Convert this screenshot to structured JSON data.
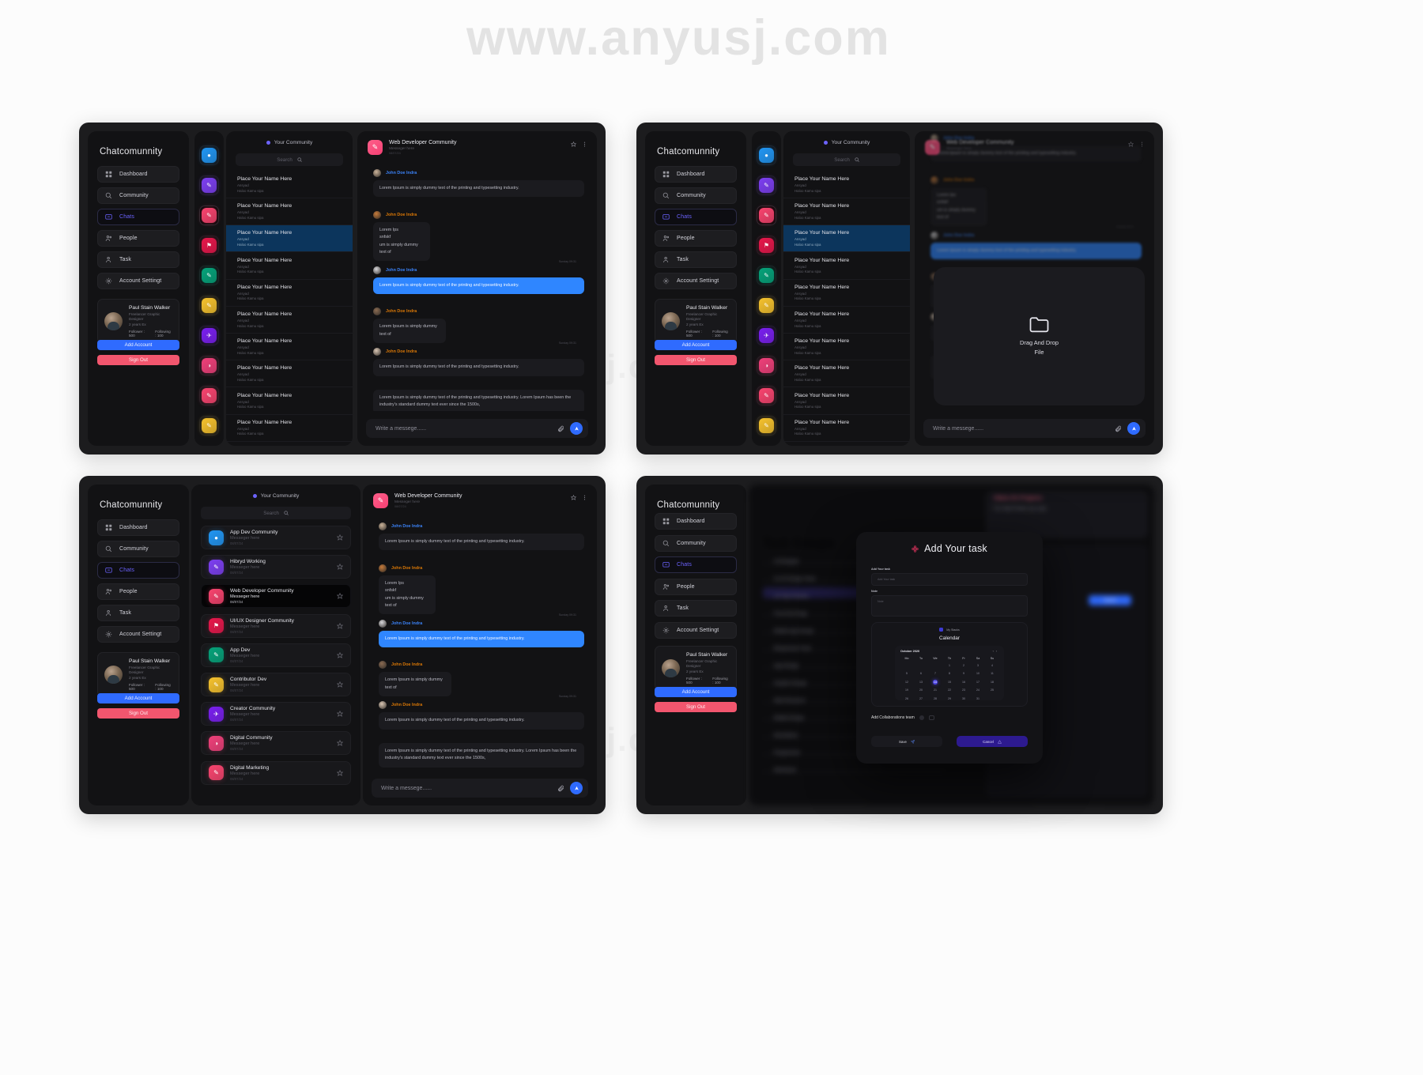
{
  "watermarks": {
    "top": "www.anyusj.com",
    "mid": "www.anyusj.com",
    "bottom": "www.anyusj.com"
  },
  "sidebar": {
    "brand": "Chatcomunnity",
    "items": [
      {
        "label": "Dashboard",
        "icon": "grid-icon",
        "active": false
      },
      {
        "label": "Community",
        "icon": "community-icon",
        "active": false
      },
      {
        "label": "Chats",
        "icon": "chat-icon",
        "active": true
      },
      {
        "label": "People",
        "icon": "people-icon",
        "active": false
      },
      {
        "label": "Task",
        "icon": "task-icon",
        "active": false
      },
      {
        "label": "Account Settingt",
        "icon": "gear-icon",
        "active": false
      }
    ],
    "profile": {
      "name": "Paul Stain Walker",
      "role": "Freelancer Graphic Designer",
      "role2": "2 years Ex",
      "followers": "Follower : 500",
      "following": "Following : 100"
    },
    "add_account": "Add Account",
    "sign_out": "Sign Out"
  },
  "rail": {
    "icons": [
      {
        "name": "app-dev-community-icon",
        "color": "#2196f3",
        "glyph": "●"
      },
      {
        "name": "hibryd-working-icon",
        "color": "#7d3ff2",
        "glyph": "✎"
      },
      {
        "name": "web-developer-community-icon",
        "color": "#f9446f",
        "glyph": "✎",
        "selected": true
      },
      {
        "name": "uiux-designer-community-icon",
        "color": "#e8174b",
        "glyph": "⚑"
      },
      {
        "name": "app-dev-icon",
        "color": "#05a37a",
        "glyph": "✎"
      },
      {
        "name": "contributor-dev-icon",
        "color": "#f6c game",
        "glyph": "✎"
      },
      {
        "name": "creator-community-icon",
        "color": "#7a1ff0",
        "glyph": "✈"
      },
      {
        "name": "digital-community-icon",
        "color": "#f0407a",
        "glyph": "◑"
      },
      {
        "name": "digital-marketing-icon",
        "color": "#f9446f",
        "glyph": "✎"
      },
      {
        "name": "extra-icon",
        "color": "#f6c22d",
        "glyph": "✎"
      }
    ]
  },
  "chat_list": {
    "header": "Your Community",
    "search_placeholder": "Search",
    "items": [
      {
        "name": "Place Your Name Here",
        "sub": "Ansyad",
        "sub2": "Haloo Kamu sipa",
        "selected": false
      },
      {
        "name": "Place Your Name Here",
        "sub": "Ansyad",
        "sub2": "Haloo Kamu sipa",
        "selected": false
      },
      {
        "name": "Place Your Name Here",
        "sub": "Ansyad",
        "sub2": "Haloo Kamu sipa",
        "selected": true
      },
      {
        "name": "Place Your Name Here",
        "sub": "Ansyad",
        "sub2": "Haloo Kamu sipa",
        "selected": false
      },
      {
        "name": "Place Your Name Here",
        "sub": "Ansyad",
        "sub2": "Haloo Kamu sipa",
        "selected": false
      },
      {
        "name": "Place Your Name Here",
        "sub": "Ansyad",
        "sub2": "Haloo Kamu sipa",
        "selected": false
      },
      {
        "name": "Place Your Name Here",
        "sub": "Ansyad",
        "sub2": "Haloo Kamu sipa",
        "selected": false
      },
      {
        "name": "Place Your Name Here",
        "sub": "Ansyad",
        "sub2": "Haloo Kamu sipa",
        "selected": false
      },
      {
        "name": "Place Your Name Here",
        "sub": "Ansyad",
        "sub2": "Haloo Kamu sipa",
        "selected": false
      },
      {
        "name": "Place Your Name Here",
        "sub": "Ansyad",
        "sub2": "Haloo Kamu sipa",
        "selected": false
      }
    ]
  },
  "community_list": {
    "header": "Your Community",
    "search_placeholder": "Search",
    "items": [
      {
        "name": "App Dev Community",
        "message": "Messeger here",
        "date": "08/07/24",
        "color": "#2196f3",
        "glyph": "●",
        "selected": false
      },
      {
        "name": "Hibryd Working",
        "message": "Messeger here",
        "date": "08/07/24",
        "color": "#7d3ff2",
        "glyph": "✎",
        "selected": false
      },
      {
        "name": "Web Developer Community",
        "message": "Messeger here",
        "date": "08/07/24",
        "color": "#f9446f",
        "glyph": "✎",
        "selected": true
      },
      {
        "name": "UI/UX Designer Community",
        "message": "Messeger here",
        "date": "08/07/24",
        "color": "#e8174b",
        "glyph": "⚑",
        "selected": false
      },
      {
        "name": "App Dev",
        "message": "Messeger here",
        "date": "08/07/24",
        "color": "#05a37a",
        "glyph": "✎",
        "selected": false
      },
      {
        "name": "Contributor Dev",
        "message": "Messeger here",
        "date": "08/07/24",
        "color": "#f6c22d",
        "glyph": "✎",
        "selected": false
      },
      {
        "name": "Creator Community",
        "message": "Messeger here",
        "date": "08/07/24",
        "color": "#7a1ff0",
        "glyph": "✈",
        "selected": false
      },
      {
        "name": "Digital Community",
        "message": "Messeger here",
        "date": "08/07/24",
        "color": "#f0407a",
        "glyph": "◑",
        "selected": false
      },
      {
        "name": "Digital Marketing",
        "message": "Messeger here",
        "date": "08/07/24",
        "color": "#f9446f",
        "glyph": "✎",
        "selected": false
      }
    ]
  },
  "conversation": {
    "title": "Web Developer Community",
    "subtitle": "Messeger here",
    "date": "08/07/24",
    "composer_placeholder": "Write a messege......",
    "timestamp": "Sunday 09:31",
    "messages": [
      {
        "author": "John Doe Indra",
        "color": "#3b82f6",
        "text": "Lorem Ipsum is simply dummy text of the printing and typesetting industry.",
        "style": "dark"
      },
      {
        "author": "John Doe Indra",
        "color": "#d97706",
        "text": "Lorem Ips\nsnfskf\num is simply dummy text of",
        "style": "dark"
      },
      {
        "author": "John Doe Indra",
        "color": "#3b82f6",
        "text": "Lorem Ipsum is simply dummy text of the printing and typesetting industry.",
        "style": "blue"
      },
      {
        "author": "John Doe Indra",
        "color": "#d97706",
        "text": "Lorem Ipsum is simply dummy text of",
        "style": "dark"
      },
      {
        "author": "John Doe Indra",
        "color": "#d97706",
        "text": "Lorem Ipsum is simply dummy text of the printing and typesetting industry.",
        "style": "dark"
      },
      {
        "author": "",
        "color": "",
        "text": "Lorem Ipsum is simply dummy text of the printing and typesetting industry. Lorem Ipsum has been the industry's standard dummy text ever since the 1500s,",
        "style": "dark"
      }
    ]
  },
  "dragdrop": {
    "line1": "Drag And Drop",
    "line2": "File",
    "icon": "folder-icon"
  },
  "task_board": {
    "heading": "Task Groups",
    "rows": [
      "UI Designer",
      "UI UX Design Team",
      "UX Tips Position",
      "Front End Page",
      "Mobile App Design",
      "Responsive Tools",
      "App Design",
      "Graphic Design",
      "Web Research",
      "Mobile Design",
      "Illustrations",
      "Programmer",
      "Wireframe"
    ],
    "highlight_index": 2,
    "right_title": "Status On Progress",
    "right_sub": "Your Hignt Position was ready",
    "right_btn": "Submit"
  },
  "modal": {
    "title": "Add Your task",
    "task_label": "Add Your task",
    "task_placeholder": "Add Your task",
    "note_label": "Note",
    "note_placeholder": "Note",
    "stacks_label": "My Stacks",
    "calendar_label": "Calendar",
    "month": "October 2020",
    "dow": [
      "Mo",
      "Tu",
      "We",
      "Th",
      "Fr",
      "Sa",
      "Su"
    ],
    "blanks": 3,
    "days": [
      1,
      2,
      3,
      4,
      5,
      6,
      7,
      8,
      9,
      10,
      11,
      12,
      13,
      14,
      15,
      16,
      17,
      18,
      19,
      20,
      21,
      22,
      23,
      24,
      25,
      26,
      27,
      28,
      29,
      30,
      31
    ],
    "selected_day": 14,
    "collab_label": "Add Collaborations team",
    "save_label": "Save",
    "cancel_label": "Cancel"
  },
  "colors": {
    "accent": "#6c63ff",
    "blue": "#2f6bff",
    "bubble_blue": "#2f86ff",
    "danger": "#f2566e",
    "selected_row": "#0c355c",
    "purple": "#2d1a8f"
  }
}
